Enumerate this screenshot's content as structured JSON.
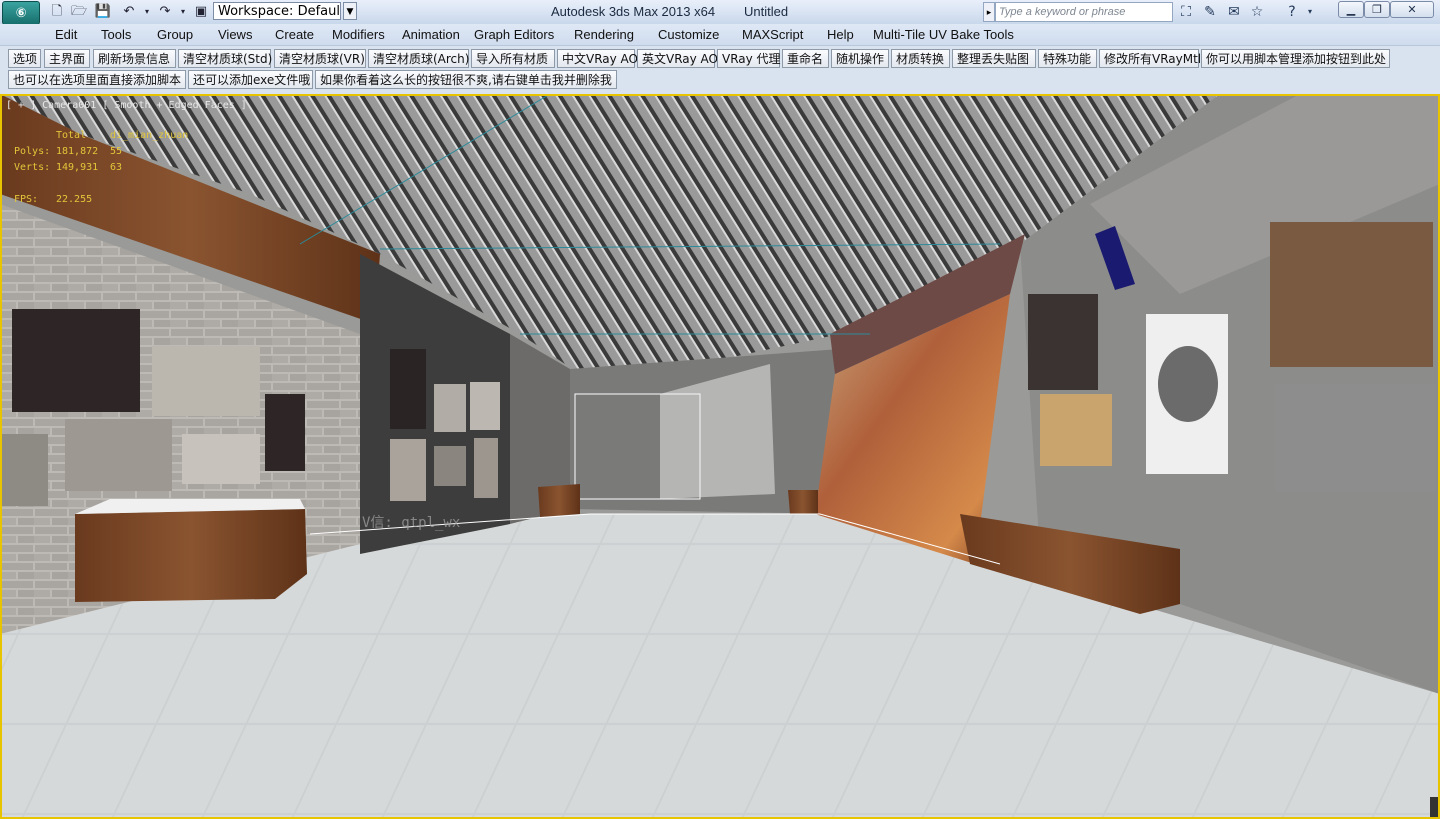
{
  "titlebar": {
    "app_title": "Autodesk 3ds Max  2013 x64",
    "doc_title": "Untitled",
    "workspace_value": "Workspace: Default",
    "search_placeholder": "Type a keyword or phrase"
  },
  "menubar": {
    "items": [
      "Edit",
      "Tools",
      "Group",
      "Views",
      "Create",
      "Modifiers",
      "Animation",
      "Graph Editors",
      "Rendering",
      "Customize",
      "MAXScript",
      "Help",
      "Multi-Tile UV Bake Tools"
    ]
  },
  "toolbar": {
    "row1": [
      "选项",
      "主界面",
      "刷新场景信息",
      "清空材质球(Std)",
      "清空材质球(VR)",
      "清空材质球(Arch)",
      "导入所有材质",
      "中文VRay AO",
      "英文VRay AO",
      "VRay 代理",
      "重命名",
      "随机操作",
      "材质转换",
      "整理丢失贴图",
      "特殊功能",
      "修改所有VRayMtl",
      "你可以用脚本管理添加按钮到此处"
    ],
    "row2": [
      "也可以在选项里面直接添加脚本",
      "还可以添加exe文件哦",
      "如果你看着这么长的按钮很不爽,请右键单击我并删除我"
    ]
  },
  "viewport": {
    "label": "[ + ] Camera001 [ Smooth + Edged Faces ]",
    "stats": {
      "header_total": "Total",
      "header_obj": "di_mian_zhuan",
      "polys_label": "Polys:",
      "polys_total": "181,872",
      "polys_obj": "55",
      "verts_label": "Verts:",
      "verts_total": "149,931",
      "verts_obj": "63",
      "fps_label": "FPS:",
      "fps_value": "22.255"
    },
    "watermark": "V信: qtpl_wx"
  },
  "colors": {
    "viewport_border": "#e8c400",
    "stats_text": "#e2c63a",
    "titlebar": "#c9d8ec"
  }
}
